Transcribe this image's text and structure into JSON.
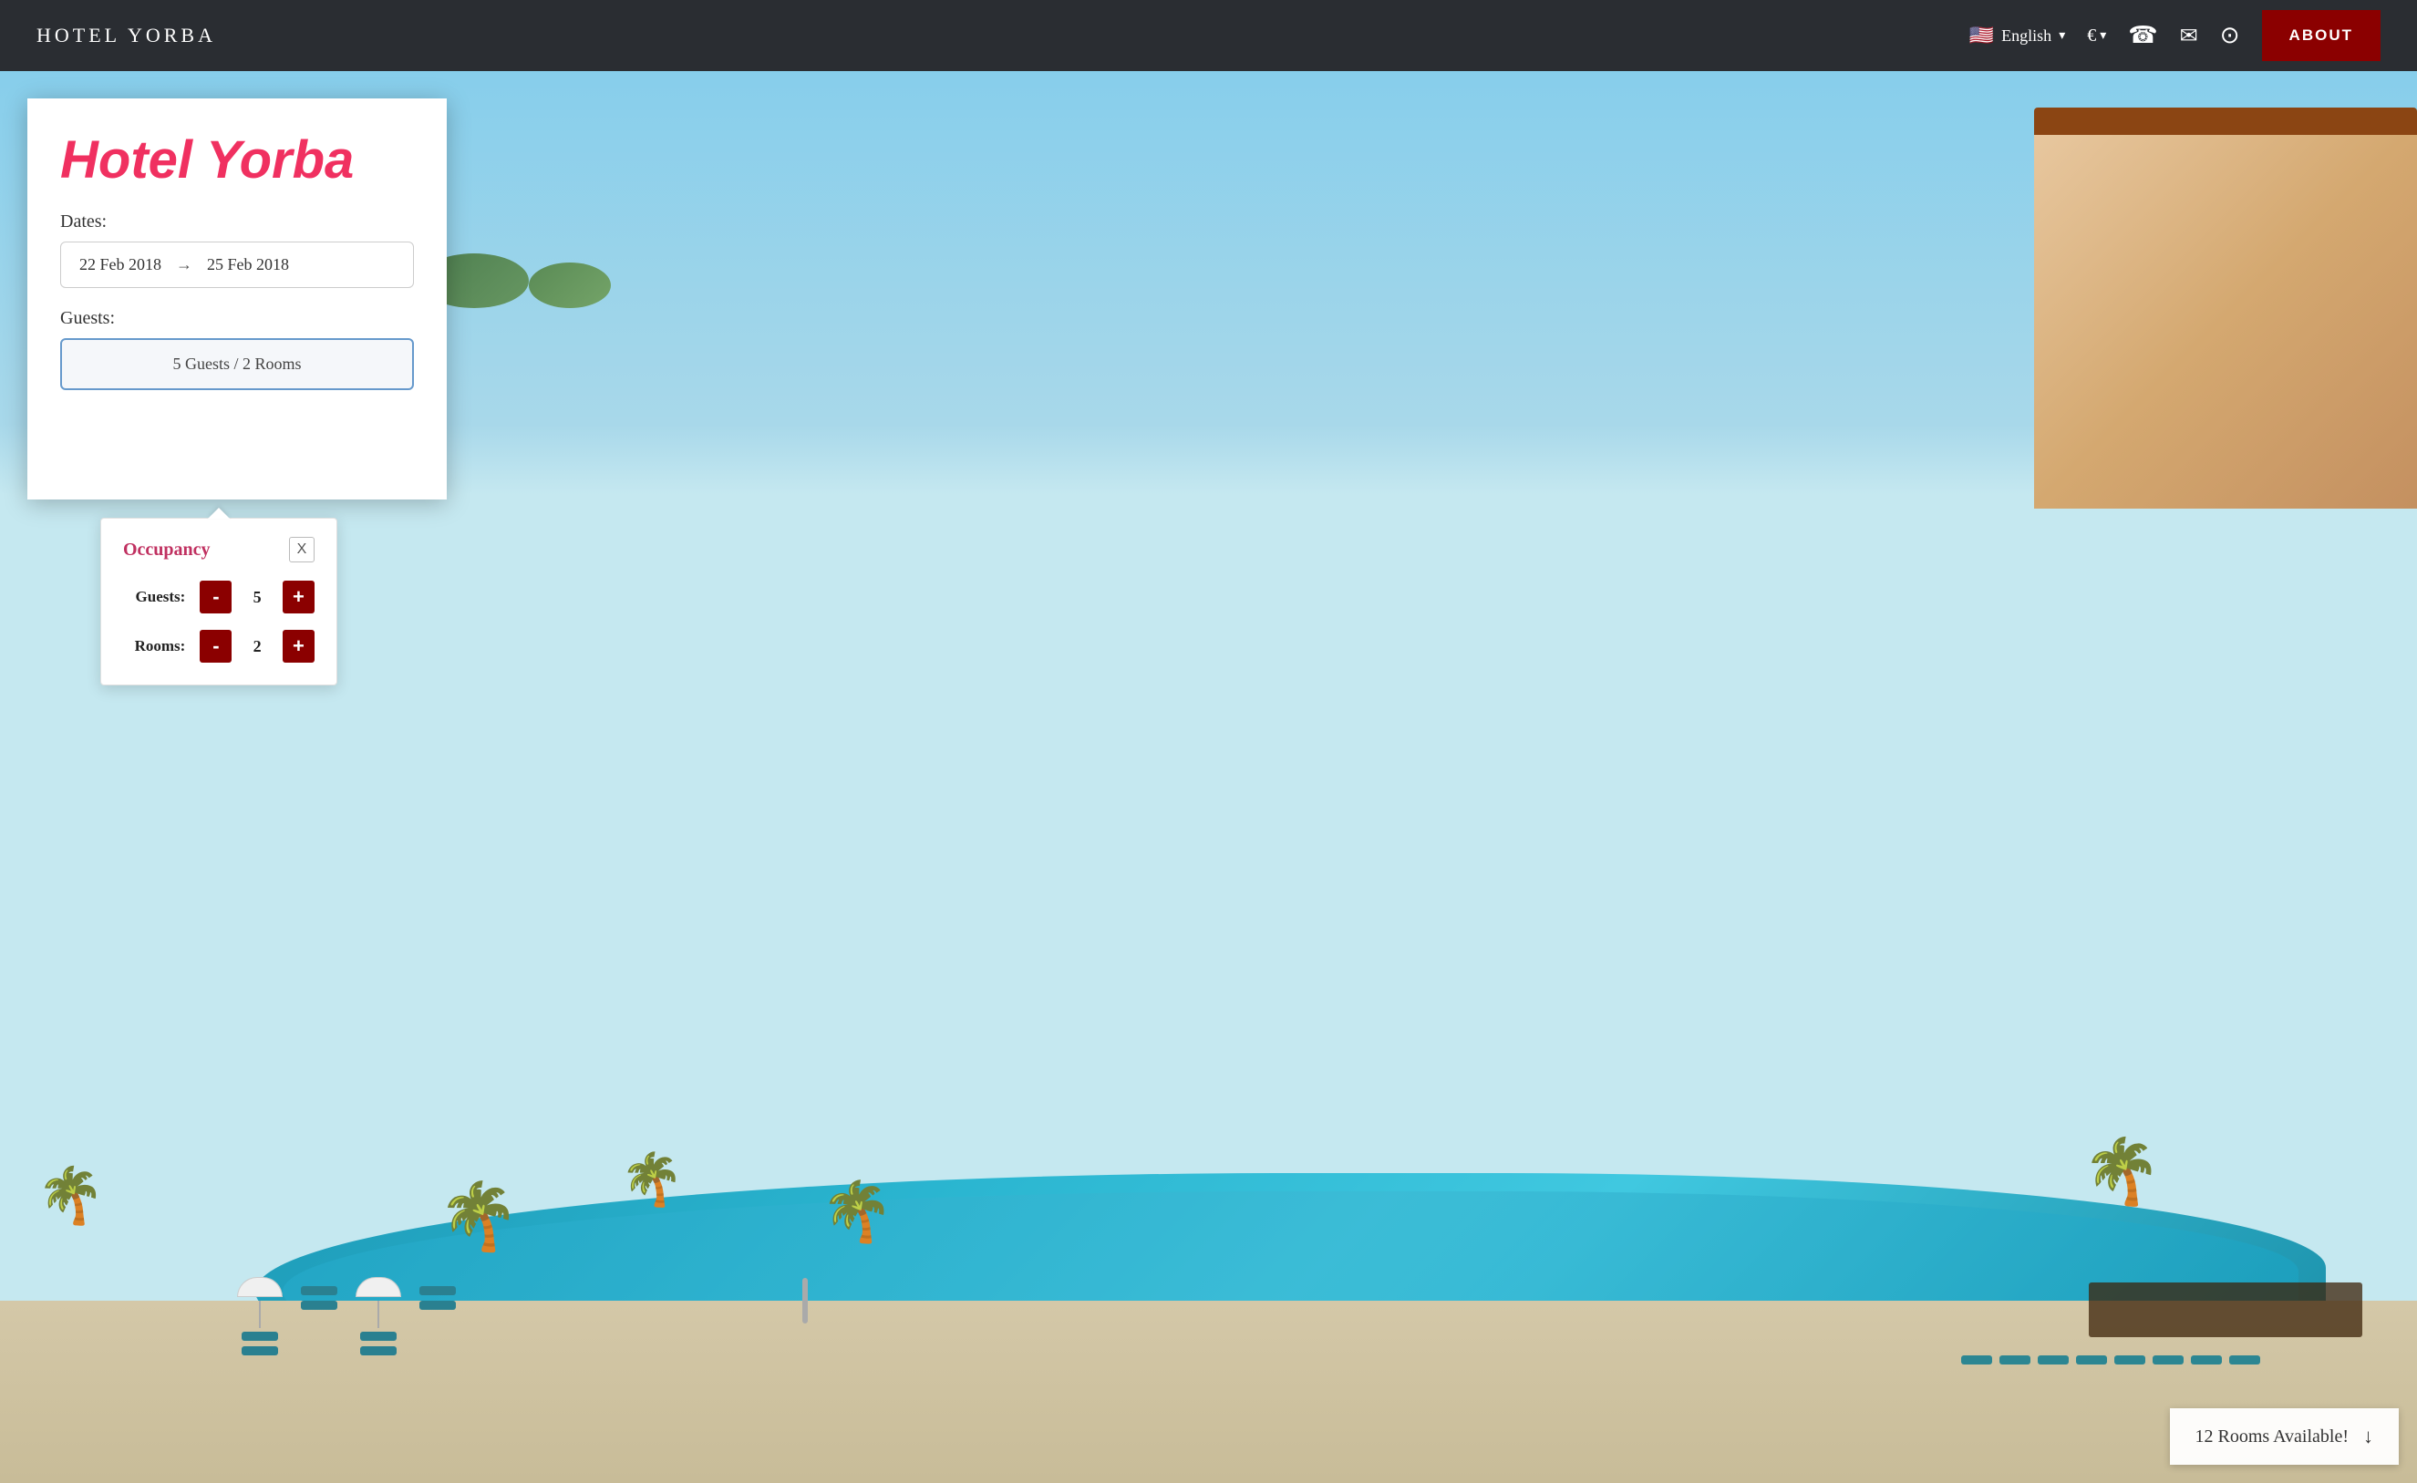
{
  "navbar": {
    "brand": "HOTEL YORBA",
    "lang_label": "English",
    "currency_label": "€",
    "currency_dropdown": "▾",
    "lang_dropdown": "▾",
    "about_label": "ABOUT"
  },
  "booking": {
    "hotel_name": "Hotel Yorba",
    "dates_label": "Dates:",
    "date_start": "22 Feb 2018",
    "date_end": "25 Feb 2018",
    "guests_label": "Guests:",
    "guests_value": "5 Guests / 2 Rooms"
  },
  "occupancy": {
    "title": "Occupancy",
    "close_label": "X",
    "guests_label": "Guests:",
    "guests_value": "5",
    "rooms_label": "Rooms:",
    "rooms_value": "2",
    "minus_label": "-",
    "plus_label": "+"
  },
  "rooms_banner": {
    "text": "12 Rooms Available!",
    "arrow": "↓"
  },
  "icons": {
    "phone": "☎",
    "mail": "✉",
    "location": "⊙",
    "arrow_right": "→"
  }
}
